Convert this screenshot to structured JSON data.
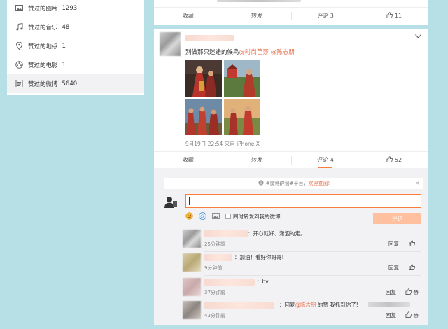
{
  "sidebar": {
    "items": [
      {
        "label": "赞过的图片",
        "count": "1293",
        "icon": "image-icon"
      },
      {
        "label": "赞过的音乐",
        "count": "48",
        "icon": "music-icon"
      },
      {
        "label": "赞过的地点",
        "count": "1",
        "icon": "location-icon"
      },
      {
        "label": "赞过的电影",
        "count": "1",
        "icon": "movie-icon"
      },
      {
        "label": "赞过的微博",
        "count": "5640",
        "icon": "weibo-icon",
        "active": true
      }
    ]
  },
  "top_post_actions": {
    "favorite": "收藏",
    "repost": "转发",
    "comment": "评论 3",
    "like": "11"
  },
  "post": {
    "text": "别做那只迷途的候鸟",
    "mention1": "@时尚芭莎",
    "mention2": "@陈志朋",
    "meta": "9月19日 22:54 来自 iPhone X",
    "actions": {
      "favorite": "收藏",
      "repost": "转发",
      "comment": "评论 4",
      "like": "52"
    }
  },
  "comments_panel": {
    "notice_text": "#微博辟谣#平台，",
    "notice_link": "欢迎查阅!",
    "input_value": "",
    "repost_checkbox_label": "同时转发到我的微博",
    "submit_label": "评论",
    "comments": [
      {
        "text": "：开心就好、潇洒的走。",
        "time": "25分钟前",
        "reply": "回复",
        "like": ""
      },
      {
        "text": "：加油！看好你哥哥!",
        "time": "9分钟前",
        "reply": "回复",
        "like": ""
      },
      {
        "text": "：bv",
        "time": "37分钟前",
        "reply": "回复",
        "like": "赞"
      },
      {
        "text_prefix": "：回复",
        "mention": "@陈志朋",
        "text_suffix": " 的赞 我抓到你了!",
        "time": "43分钟前",
        "reply": "回复",
        "like": "赞"
      }
    ]
  },
  "colors": {
    "accent": "#fa7d3c",
    "mention": "#eb7350",
    "background": "#b6dfe6"
  }
}
